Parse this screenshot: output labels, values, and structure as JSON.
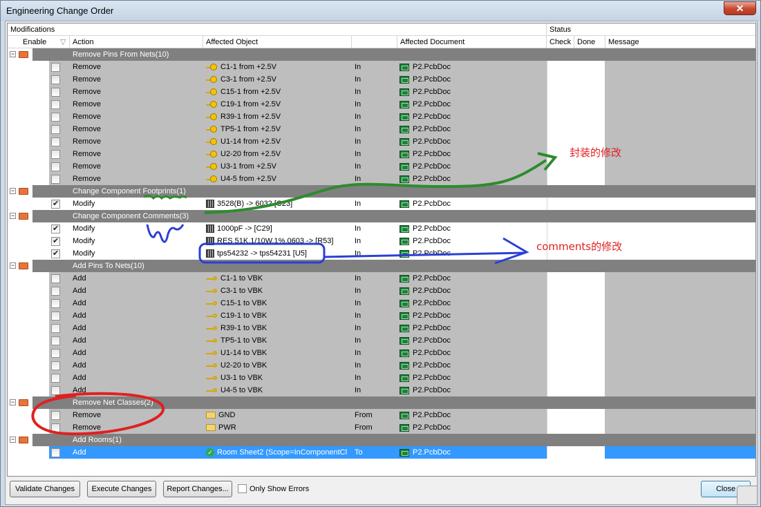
{
  "window": {
    "title": "Engineering Change Order",
    "close": "✕"
  },
  "headers": {
    "modifications": "Modifications",
    "status": "Status",
    "enable": "Enable",
    "action": "Action",
    "affected_object": "Affected Object",
    "affected_document": "Affected Document",
    "check": "Check",
    "done": "Done",
    "message": "Message"
  },
  "rows": [
    {
      "type": "group",
      "label": "Remove Pins From Nets(10)"
    },
    {
      "type": "item",
      "checked": false,
      "action": "Remove",
      "icon": "pin-net",
      "object": "C1-1 from +2.5V",
      "dir": "In",
      "doc": "P2.PcbDoc"
    },
    {
      "type": "item",
      "checked": false,
      "action": "Remove",
      "icon": "pin-net",
      "object": "C3-1 from +2.5V",
      "dir": "In",
      "doc": "P2.PcbDoc"
    },
    {
      "type": "item",
      "checked": false,
      "action": "Remove",
      "icon": "pin-net",
      "object": "C15-1 from +2.5V",
      "dir": "In",
      "doc": "P2.PcbDoc"
    },
    {
      "type": "item",
      "checked": false,
      "action": "Remove",
      "icon": "pin-net",
      "object": "C19-1 from +2.5V",
      "dir": "In",
      "doc": "P2.PcbDoc"
    },
    {
      "type": "item",
      "checked": false,
      "action": "Remove",
      "icon": "pin-net",
      "object": "R39-1 from +2.5V",
      "dir": "In",
      "doc": "P2.PcbDoc"
    },
    {
      "type": "item",
      "checked": false,
      "action": "Remove",
      "icon": "pin-net",
      "object": "TP5-1 from +2.5V",
      "dir": "In",
      "doc": "P2.PcbDoc"
    },
    {
      "type": "item",
      "checked": false,
      "action": "Remove",
      "icon": "pin-net",
      "object": "U1-14 from +2.5V",
      "dir": "In",
      "doc": "P2.PcbDoc"
    },
    {
      "type": "item",
      "checked": false,
      "action": "Remove",
      "icon": "pin-net",
      "object": "U2-20 from +2.5V",
      "dir": "In",
      "doc": "P2.PcbDoc"
    },
    {
      "type": "item",
      "checked": false,
      "action": "Remove",
      "icon": "pin-net",
      "object": "U3-1 from +2.5V",
      "dir": "In",
      "doc": "P2.PcbDoc"
    },
    {
      "type": "item",
      "checked": false,
      "action": "Remove",
      "icon": "pin-net",
      "object": "U4-5 from +2.5V",
      "dir": "In",
      "doc": "P2.PcbDoc"
    },
    {
      "type": "group",
      "label": "Change Component Footprints(1)"
    },
    {
      "type": "item",
      "checked": true,
      "white": true,
      "action": "Modify",
      "icon": "component",
      "object": "3528(B) -> 6032 [C23]",
      "dir": "In",
      "doc": "P2.PcbDoc"
    },
    {
      "type": "group",
      "label": "Change Component Comments(3)"
    },
    {
      "type": "item",
      "checked": true,
      "white": true,
      "action": "Modify",
      "icon": "component",
      "object": "1000pF ->  [C29]",
      "dir": "In",
      "doc": "P2.PcbDoc"
    },
    {
      "type": "item",
      "checked": true,
      "white": true,
      "action": "Modify",
      "icon": "component",
      "object": "RES  51K,1/10W,1%,0603 ->  [R53]",
      "dir": "In",
      "doc": "P2.PcbDoc"
    },
    {
      "type": "item",
      "checked": true,
      "white": true,
      "action": "Modify",
      "icon": "component",
      "object": "tps54232 -> tps54231 [U5]",
      "dir": "In",
      "doc": "P2.PcbDoc"
    },
    {
      "type": "group",
      "label": "Add Pins To Nets(10)"
    },
    {
      "type": "item",
      "checked": false,
      "action": "Add",
      "icon": "pin-add",
      "object": "C1-1 to VBK",
      "dir": "In",
      "doc": "P2.PcbDoc"
    },
    {
      "type": "item",
      "checked": false,
      "action": "Add",
      "icon": "pin-add",
      "object": "C3-1 to VBK",
      "dir": "In",
      "doc": "P2.PcbDoc"
    },
    {
      "type": "item",
      "checked": false,
      "action": "Add",
      "icon": "pin-add",
      "object": "C15-1 to VBK",
      "dir": "In",
      "doc": "P2.PcbDoc"
    },
    {
      "type": "item",
      "checked": false,
      "action": "Add",
      "icon": "pin-add",
      "object": "C19-1 to VBK",
      "dir": "In",
      "doc": "P2.PcbDoc"
    },
    {
      "type": "item",
      "checked": false,
      "action": "Add",
      "icon": "pin-add",
      "object": "R39-1 to VBK",
      "dir": "In",
      "doc": "P2.PcbDoc"
    },
    {
      "type": "item",
      "checked": false,
      "action": "Add",
      "icon": "pin-add",
      "object": "TP5-1 to VBK",
      "dir": "In",
      "doc": "P2.PcbDoc"
    },
    {
      "type": "item",
      "checked": false,
      "action": "Add",
      "icon": "pin-add",
      "object": "U1-14 to VBK",
      "dir": "In",
      "doc": "P2.PcbDoc"
    },
    {
      "type": "item",
      "checked": false,
      "action": "Add",
      "icon": "pin-add",
      "object": "U2-20 to VBK",
      "dir": "In",
      "doc": "P2.PcbDoc"
    },
    {
      "type": "item",
      "checked": false,
      "action": "Add",
      "icon": "pin-add",
      "object": "U3-1 to VBK",
      "dir": "In",
      "doc": "P2.PcbDoc"
    },
    {
      "type": "item",
      "checked": false,
      "action": "Add",
      "icon": "pin-add",
      "object": "U4-5 to VBK",
      "dir": "In",
      "doc": "P2.PcbDoc"
    },
    {
      "type": "group",
      "label": "Remove Net Classes(2)"
    },
    {
      "type": "item",
      "checked": false,
      "action": "Remove",
      "icon": "folder",
      "object": "GND",
      "dir": "From",
      "doc": "P2.PcbDoc"
    },
    {
      "type": "item",
      "checked": false,
      "action": "Remove",
      "icon": "folder",
      "object": "PWR",
      "dir": "From",
      "doc": "P2.PcbDoc"
    },
    {
      "type": "group",
      "label": "Add Rooms(1)"
    },
    {
      "type": "item",
      "checked": false,
      "selected": true,
      "action": "Add",
      "icon": "check-green",
      "object": "Room Sheet2 (Scope=InComponentCl",
      "dir": "To",
      "doc": "P2.PcbDoc"
    }
  ],
  "buttons": {
    "validate": "Validate Changes",
    "execute": "Execute Changes",
    "report": "Report Changes...",
    "only_errors": "Only Show Errors",
    "close": "Close"
  },
  "annotations": {
    "footprint_note": "封装的修改",
    "comments_note": "comments的修改"
  },
  "colors": {
    "group_bg": "#808080",
    "row_gray": "#bebebe",
    "selected": "#3399ff",
    "annot_green": "#2e8b2e",
    "annot_blue": "#2a3fd6",
    "annot_red": "#e02020"
  }
}
